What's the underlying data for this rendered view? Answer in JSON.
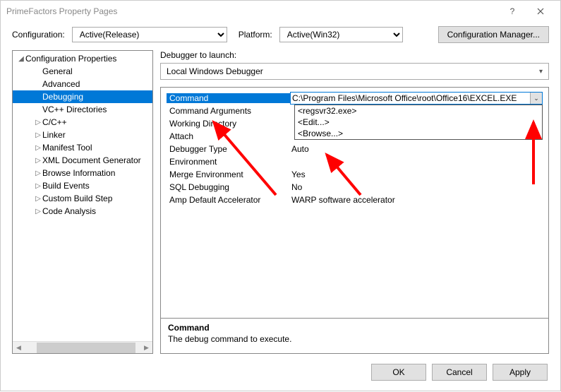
{
  "window": {
    "title": "PrimeFactors Property Pages"
  },
  "toprow": {
    "config_label": "Configuration:",
    "config_value": "Active(Release)",
    "platform_label": "Platform:",
    "platform_value": "Active(Win32)",
    "cfgmgr": "Configuration Manager..."
  },
  "tree": {
    "root": "Configuration Properties",
    "items": [
      {
        "label": "General",
        "arrow": false
      },
      {
        "label": "Advanced",
        "arrow": false
      },
      {
        "label": "Debugging",
        "arrow": false,
        "selected": true
      },
      {
        "label": "VC++ Directories",
        "arrow": false
      },
      {
        "label": "C/C++",
        "arrow": true
      },
      {
        "label": "Linker",
        "arrow": true
      },
      {
        "label": "Manifest Tool",
        "arrow": true
      },
      {
        "label": "XML Document Generator",
        "arrow": true
      },
      {
        "label": "Browse Information",
        "arrow": true
      },
      {
        "label": "Build Events",
        "arrow": true
      },
      {
        "label": "Custom Build Step",
        "arrow": true
      },
      {
        "label": "Code Analysis",
        "arrow": true
      }
    ]
  },
  "launcher": {
    "label": "Debugger to launch:",
    "value": "Local Windows Debugger"
  },
  "grid": {
    "rows": [
      {
        "key": "Command",
        "value": "C:\\Program Files\\Microsoft Office\\root\\Office16\\EXCEL.EXE",
        "active": true
      },
      {
        "key": "Command Arguments",
        "value": ""
      },
      {
        "key": "Working Directory",
        "value": ""
      },
      {
        "key": "Attach",
        "value": ""
      },
      {
        "key": "Debugger Type",
        "value": "Auto"
      },
      {
        "key": "Environment",
        "value": ""
      },
      {
        "key": "Merge Environment",
        "value": "Yes"
      },
      {
        "key": "SQL Debugging",
        "value": "No"
      },
      {
        "key": "Amp Default Accelerator",
        "value": "WARP software accelerator"
      }
    ],
    "dropdown": [
      "<regsvr32.exe>",
      "<Edit...>",
      "<Browse...>"
    ]
  },
  "desc": {
    "title": "Command",
    "text": "The debug command to execute."
  },
  "footer": {
    "ok": "OK",
    "cancel": "Cancel",
    "apply": "Apply"
  }
}
